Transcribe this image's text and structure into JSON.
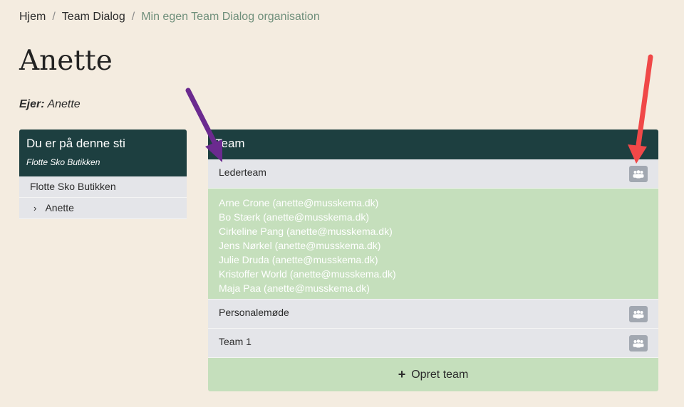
{
  "breadcrumb": {
    "items": [
      "Hjem",
      "Team Dialog",
      "Min egen Team Dialog organisation"
    ],
    "separator": "/"
  },
  "page_title": "Anette",
  "owner": {
    "label": "Ejer:",
    "value": "Anette"
  },
  "path_panel": {
    "title": "Du er på denne sti",
    "subtitle": "Flotte Sko Butikken",
    "items": [
      {
        "label": "Flotte Sko Butikken"
      },
      {
        "label": "Anette"
      }
    ]
  },
  "team_panel": {
    "title": "Team",
    "teams": [
      {
        "name": "Lederteam"
      },
      {
        "name": "Personalemøde"
      },
      {
        "name": "Team 1"
      }
    ],
    "members": [
      "Arne Crone (anette@musskema.dk)",
      "Bo Stærk (anette@musskema.dk)",
      "Cirkeline Pang (anette@musskema.dk)",
      "Jens Nørkel (anette@musskema.dk)",
      "Julie Druda (anette@musskema.dk)",
      "Kristoffer World (anette@musskema.dk)",
      "Maja Paa (anette@musskema.dk)"
    ],
    "create_label": "Opret team"
  },
  "icons": {
    "team_members": "users-icon",
    "create": "plus-icon",
    "chevron": "chevron-right-icon"
  },
  "colors": {
    "header_bg": "#1d3f40",
    "page_bg": "#f4ece0",
    "row_bg": "#e4e5e9",
    "members_bg": "#c5dfbc",
    "annotation_purple": "#6b2a8f",
    "annotation_red": "#f04848"
  }
}
